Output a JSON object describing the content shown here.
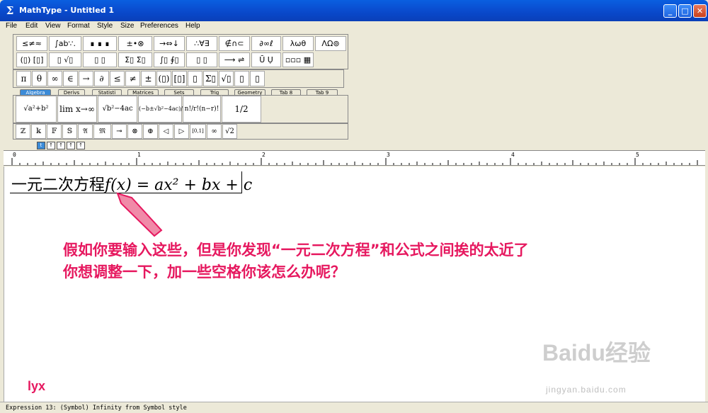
{
  "window": {
    "title": "MathType - Untitled 1",
    "icon": "sigma-icon",
    "controls": [
      "minimize-icon",
      "maximize-icon",
      "close-icon"
    ]
  },
  "menu": [
    "File",
    "Edit",
    "View",
    "Format",
    "Style",
    "Size",
    "Preferences",
    "Help"
  ],
  "palettes": {
    "row1": [
      "≤≠≈",
      "∫ab∵.",
      "∎ ∎ ∎",
      "±•⊗",
      "→⇔↓",
      "∴∀∃",
      "∉∩⊂",
      "∂∞ℓ",
      "λωθ",
      "ΛΩ⊚"
    ],
    "row2": [
      "(▯) [▯]",
      "▯ √▯",
      "▯ ▯",
      "Σ▯ Σ▯",
      "∫▯ ∮▯",
      "▯ ▯",
      "⟶ ⇌",
      "Ū Ụ",
      "▫▫▫ ▦"
    ],
    "row3": [
      "π",
      "θ",
      "∞",
      "∈",
      "→",
      "∂",
      "≤",
      "≠",
      "±",
      "(▯)",
      "[▯]",
      "▯",
      "Σ▯",
      "√▯",
      "▯",
      "▯"
    ],
    "tabs": [
      "Algebra",
      "Derivs",
      "Statisti",
      "Matrices",
      "Sets",
      "Trig",
      "Geometry",
      "Tab 8",
      "Tab 9"
    ],
    "templates": [
      "√a²+b²",
      "lim x→∞",
      "√b²−4ac",
      "(−b±√b²−4ac)/2a",
      "n!/r!(n−r)!",
      "1/2"
    ],
    "row4": [
      "ℤ",
      "𝕜",
      "𝔽",
      "𝕊",
      "𝔄",
      "𝔐",
      "⊸",
      "⊗",
      "⊕",
      "◁",
      "▷",
      "[0,1]",
      "∞",
      "√2"
    ],
    "size_buttons": [
      "t",
      "↑",
      "↑",
      "↑",
      "↑"
    ]
  },
  "ruler": [
    "0",
    "1",
    "2",
    "3",
    "4",
    "5"
  ],
  "editor": {
    "chinese_text": "一元二次方程",
    "formula": "f(x) = ax² + bx + c",
    "annotation_line1": "假如你要输入这些，但是你发现“一元二次方程”和公式之间挨的太近了",
    "annotation_line2": "你想调整一下，加一些空格你该怎么办呢？",
    "author": "lyx",
    "watermark": "Baidu经验",
    "watermark_sub": "jingyan.baidu.com"
  },
  "status": "Expression 13:  (Symbol) Infinity from Symbol style",
  "colors": {
    "title_bar": "#0a4fd2",
    "annotation": "#e6185f",
    "active_tab": "#3b8bd8"
  }
}
